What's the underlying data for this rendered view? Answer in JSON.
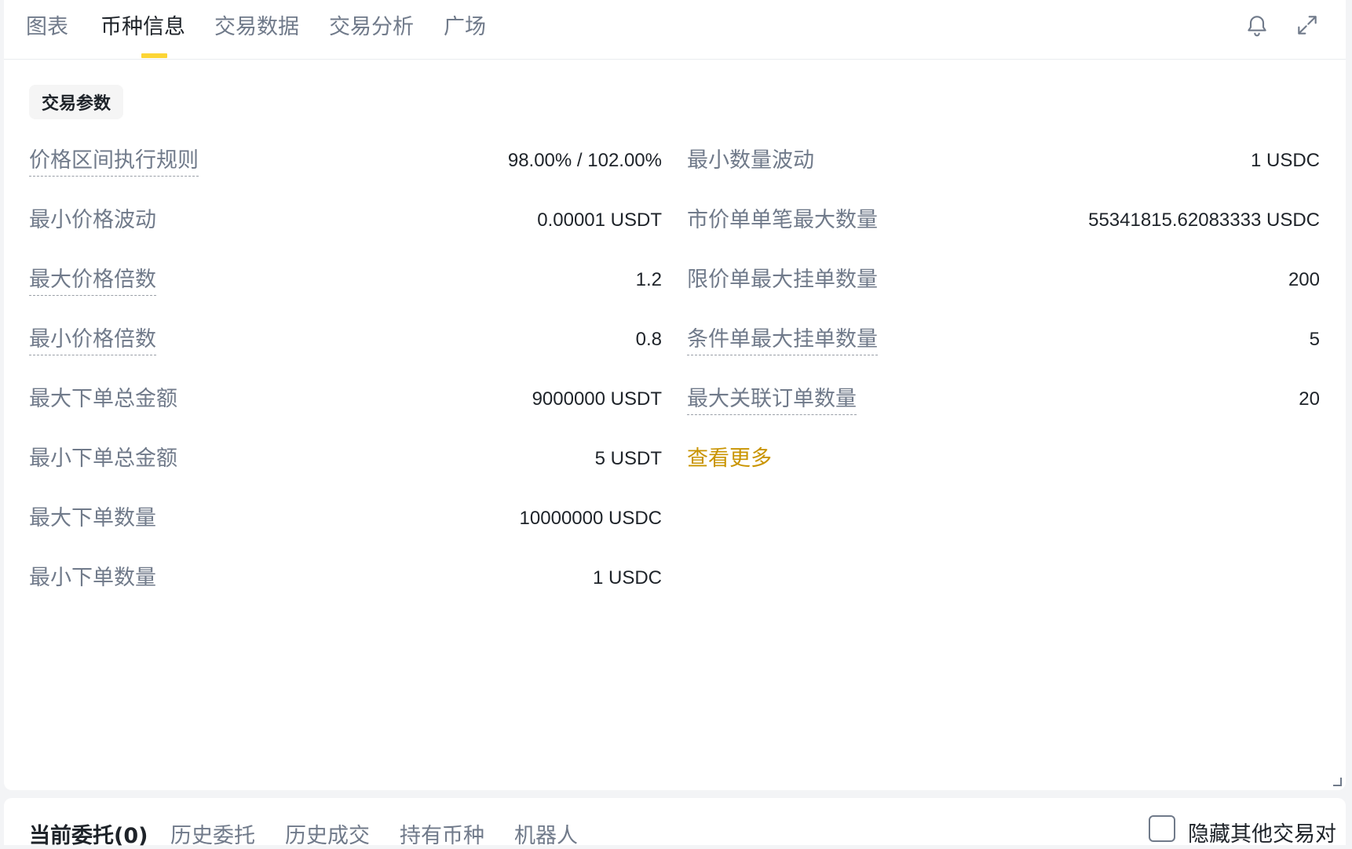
{
  "tabs": [
    {
      "label": "图表"
    },
    {
      "label": "币种信息"
    },
    {
      "label": "交易数据"
    },
    {
      "label": "交易分析"
    },
    {
      "label": "广场"
    }
  ],
  "active_tab": "币种信息",
  "section_title": "交易参数",
  "left_rows": [
    {
      "label": "价格区间执行规则",
      "value": "98.00% / 102.00%"
    },
    {
      "label": "最小价格波动",
      "value": "0.00001 USDT"
    },
    {
      "label": "最大价格倍数",
      "value": "1.2"
    },
    {
      "label": "最小价格倍数",
      "value": "0.8"
    },
    {
      "label": "最大下单总金额",
      "value": "9000000 USDT"
    },
    {
      "label": "最小下单总金额",
      "value": "5 USDT"
    },
    {
      "label": "最大下单数量",
      "value": "10000000 USDC"
    },
    {
      "label": "最小下单数量",
      "value": "1 USDC"
    }
  ],
  "right_rows": [
    {
      "label": "最小数量波动",
      "value": "1 USDC"
    },
    {
      "label": "市价单单笔最大数量",
      "value": "55341815.62083333 USDC"
    },
    {
      "label": "限价单最大挂单数量",
      "value": "200"
    },
    {
      "label": "条件单最大挂单数量",
      "value": "5"
    },
    {
      "label": "最大关联订单数量",
      "value": "20"
    }
  ],
  "more_link": "查看更多",
  "icons": {
    "bell": "bell-icon",
    "expand": "expand-icon"
  },
  "colors": {
    "accent_yellow": "#fcd535",
    "link_gold": "#c99400",
    "text_primary": "#1e2329",
    "text_secondary": "#707a8a"
  },
  "bottom": {
    "tabs": [
      {
        "label": "当前委托(0)"
      },
      {
        "label": "历史委托"
      },
      {
        "label": "历史成交"
      },
      {
        "label": "持有币种"
      },
      {
        "label": "机器人"
      }
    ],
    "hide_other_pairs": "隐藏其他交易对"
  }
}
